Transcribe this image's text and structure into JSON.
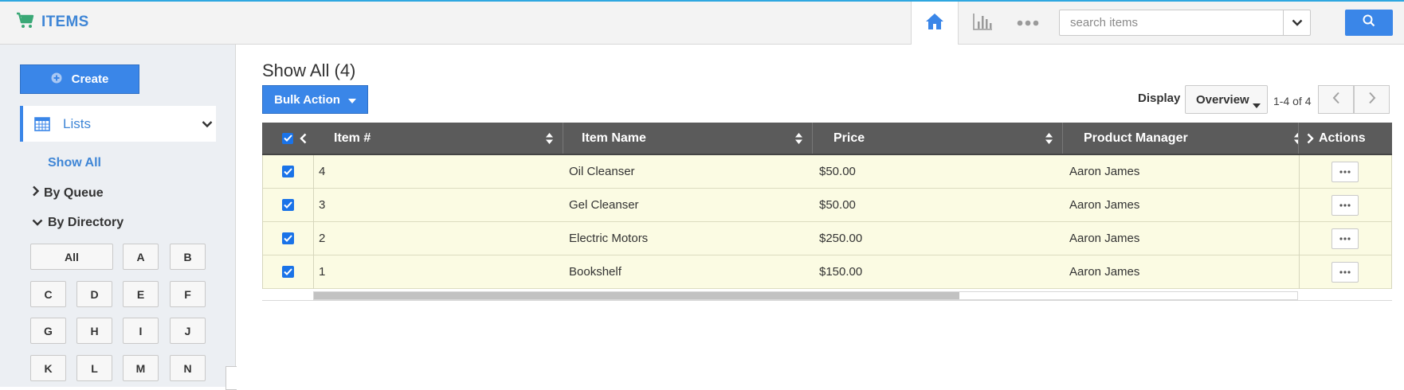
{
  "app": {
    "title": "ITEMS",
    "icon": "cart-icon",
    "accent": "#3a86e8"
  },
  "topnav": {
    "home_icon": "home-icon",
    "chart_icon": "bar-chart-icon",
    "more_icon": "more-dots-icon",
    "search": {
      "placeholder": "search items",
      "value": ""
    }
  },
  "sidebar": {
    "create_label": "Create",
    "lists_label": "Lists",
    "show_all": "Show All",
    "by_queue": "By Queue",
    "by_directory": "By Directory",
    "directory": [
      "All",
      "A",
      "B",
      "C",
      "D",
      "E",
      "F",
      "G",
      "H",
      "I",
      "J",
      "K",
      "L",
      "M",
      "N"
    ]
  },
  "main": {
    "title": "Show All (4)",
    "bulk_action": "Bulk Action",
    "display_label": "Display",
    "display_value": "Overview",
    "range": "1-4 of 4"
  },
  "table": {
    "columns": [
      "Item #",
      "Item Name",
      "Price",
      "Product Manager",
      "Actions"
    ],
    "rows": [
      {
        "item_no": "4",
        "name": "Oil Cleanser",
        "price": "$50.00",
        "manager": "Aaron James"
      },
      {
        "item_no": "3",
        "name": "Gel Cleanser",
        "price": "$50.00",
        "manager": "Aaron James"
      },
      {
        "item_no": "2",
        "name": "Electric Motors",
        "price": "$250.00",
        "manager": "Aaron James"
      },
      {
        "item_no": "1",
        "name": "Bookshelf",
        "price": "$150.00",
        "manager": "Aaron James"
      }
    ]
  }
}
